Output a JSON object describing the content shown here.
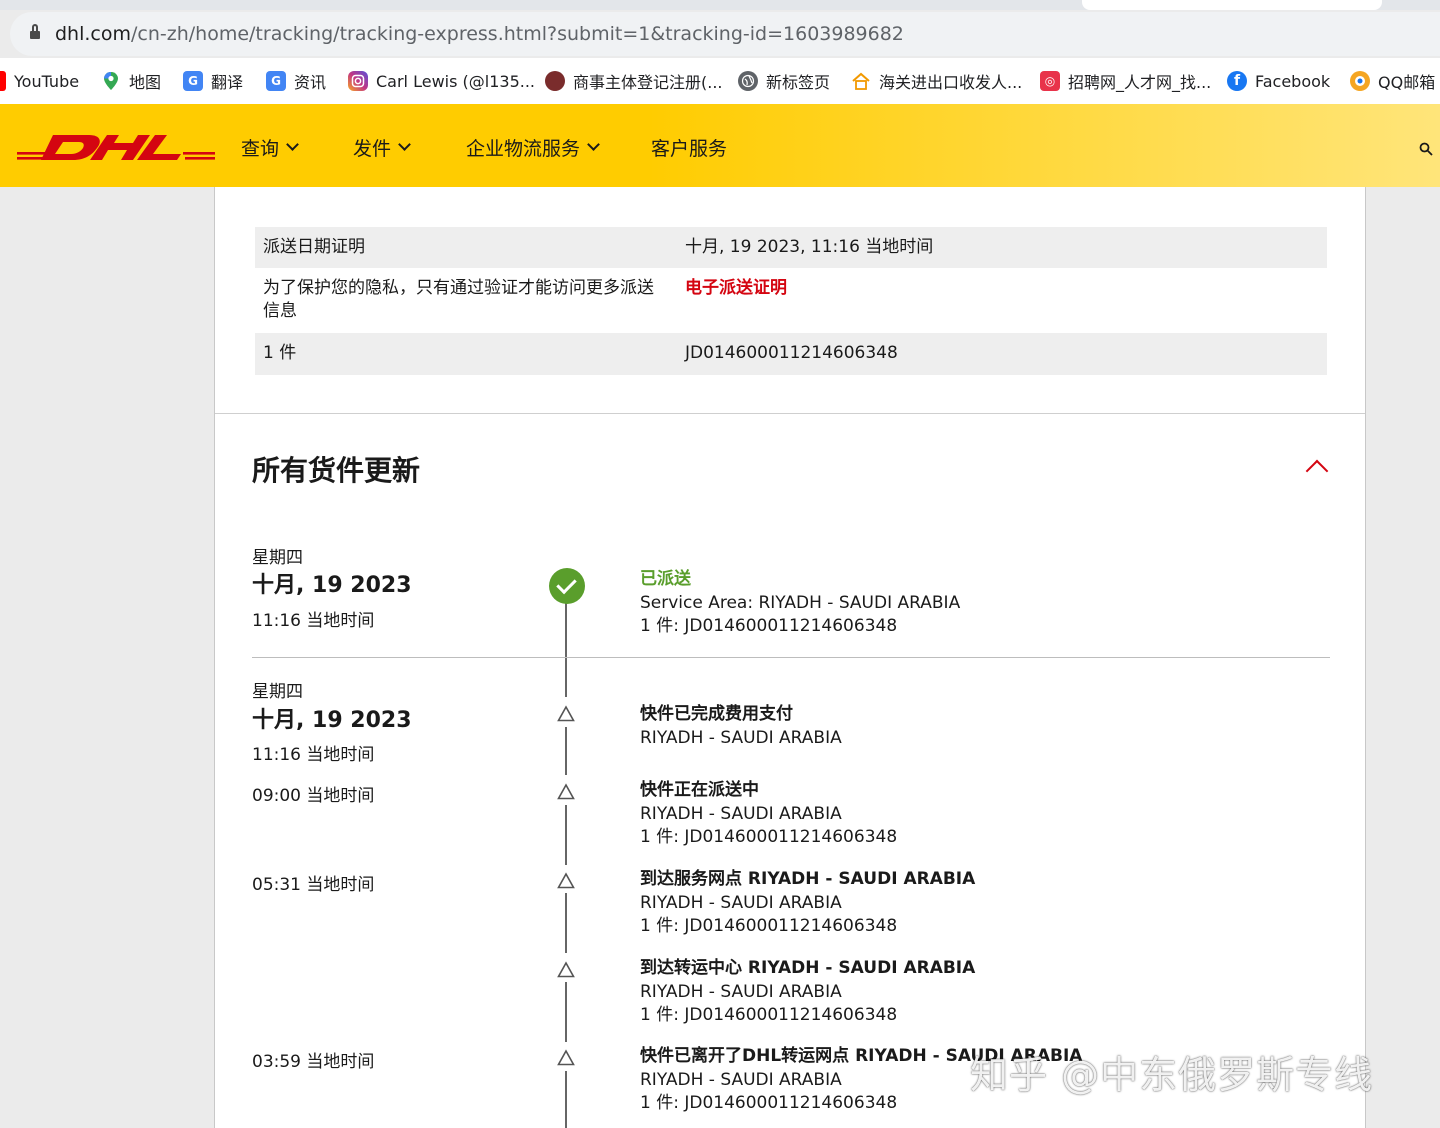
{
  "browser": {
    "url_host": "dhl.com",
    "url_path": "/cn-zh/home/tracking/tracking-express.html?submit=1&tracking-id=1603989682",
    "bookmarks": [
      {
        "label": "YouTube",
        "icon": "youtube-icon",
        "color": "#ff0000"
      },
      {
        "label": "地图",
        "icon": "map-pin-icon",
        "color": "#34a853"
      },
      {
        "label": "翻译",
        "icon": "translate-icon",
        "color": "#4285f4"
      },
      {
        "label": "资讯",
        "icon": "news-icon",
        "color": "#4285f4"
      },
      {
        "label": "Carl Lewis (@l135...",
        "icon": "instagram-icon",
        "color": "#c13584"
      },
      {
        "label": "商事主体登记注册(...",
        "icon": "seal-icon",
        "color": "#8b2e2e"
      },
      {
        "label": "新标签页",
        "icon": "globe-icon",
        "color": "#5f6368"
      },
      {
        "label": "海关进出口收发人...",
        "icon": "house-icon",
        "color": "#f29900"
      },
      {
        "label": "招聘网_人才网_找...",
        "icon": "job-app-icon",
        "color": "#e8334a"
      },
      {
        "label": "Facebook",
        "icon": "facebook-icon",
        "color": "#1877f2"
      },
      {
        "label": "QQ邮箱",
        "icon": "qq-mail-icon",
        "color": "#f5a623"
      }
    ]
  },
  "header": {
    "nav": [
      "查询",
      "发件",
      "企业物流服务",
      "客户服务"
    ],
    "colors": {
      "brand_yellow": "#ffcc00",
      "brand_red": "#d40511"
    }
  },
  "details": {
    "rows": [
      {
        "label": "派送日期证明",
        "value": "十月, 19 2023, 11:16 当地时间"
      },
      {
        "label": "为了保护您的隐私，只有通过验证才能访问更多派送信息",
        "value": "电子派送证明"
      },
      {
        "label": "1 件",
        "value": "JD014600011214606348"
      }
    ]
  },
  "updates": {
    "title": "所有货件更新",
    "groups": [
      {
        "weekday": "星期四",
        "date": "十月, 19 2023",
        "events": [
          {
            "time": "11:16 当地时间",
            "status": "已派送",
            "location": "Service Area: RIYADH - SAUDI ARABIA",
            "pieces": "1 件: JD014600011214606348",
            "delivered": true
          }
        ]
      },
      {
        "weekday": "星期四",
        "date": "十月, 19 2023",
        "events": [
          {
            "time": "11:16 当地时间",
            "status": "快件已完成费用支付",
            "location": "RIYADH - SAUDI ARABIA",
            "pieces": ""
          },
          {
            "time": "09:00 当地时间",
            "status": "快件正在派送中",
            "location": "RIYADH - SAUDI ARABIA",
            "pieces": "1 件: JD014600011214606348"
          },
          {
            "time": "05:31 当地时间",
            "status": "到达服务网点 RIYADH - SAUDI ARABIA",
            "location": "RIYADH - SAUDI ARABIA",
            "pieces": "1 件: JD014600011214606348"
          },
          {
            "time": "",
            "status": "到达转运中心 RIYADH - SAUDI ARABIA",
            "location": "RIYADH - SAUDI ARABIA",
            "pieces": "1 件: JD014600011214606348"
          },
          {
            "time": "03:59 当地时间",
            "status": "快件已离开了DHL转运网点 RIYADH - SAUDI ARABIA",
            "location": "RIYADH - SAUDI ARABIA",
            "pieces": "1 件: JD014600011214606348"
          }
        ]
      }
    ]
  },
  "watermark": "知乎 @中东俄罗斯专线"
}
